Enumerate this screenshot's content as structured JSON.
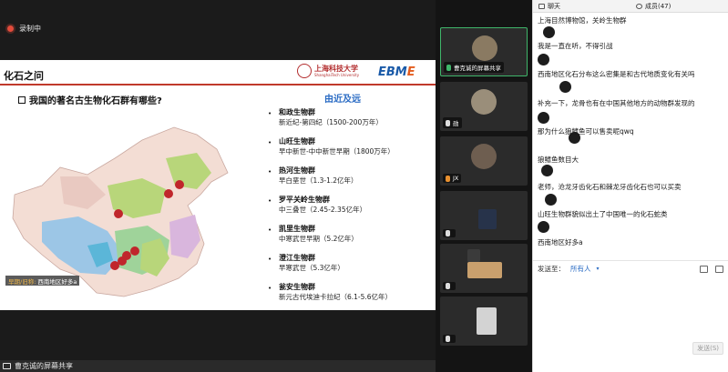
{
  "recording": {
    "label": "录制中"
  },
  "slide": {
    "title": "化石之问",
    "university_name": "上海科技大学",
    "university_sub": "ShanghaiTech University",
    "logo_main": "EBM",
    "logo_accent": "E",
    "question": "我国的著名古生物化石群有哪些?",
    "order": "由近及远",
    "biotas": [
      {
        "name": "和政生物群",
        "age": "新近纪-第四纪（1500-200万年）"
      },
      {
        "name": "山旺生物群",
        "age": "早中新世-中中新世早期（1800万年）"
      },
      {
        "name": "热河生物群",
        "age": "早白垩世（1.3-1.2亿年）"
      },
      {
        "name": "罗平关岭生物群",
        "age": "中三叠世（2.45-2.35亿年）"
      },
      {
        "name": "凯里生物群",
        "age": "中寒武世早期（5.2亿年）"
      },
      {
        "name": "澄江生物群",
        "age": "早寒武世（5.3亿年）"
      },
      {
        "name": "瓮安生物群",
        "age": "新元古代埃迪卡拉纪（6.1-5.6亿年）"
      }
    ],
    "caption_tag": "早期/旧称:",
    "caption_text": "西南地区好多a"
  },
  "share_footer": {
    "label": "曹克诚的屏幕共享"
  },
  "participants": [
    {
      "label": "曹克诚的屏幕共享",
      "active": true
    },
    {
      "label": "勋"
    },
    {
      "label": "JX"
    },
    {
      "label": ""
    },
    {
      "label": ""
    },
    {
      "label": ""
    }
  ],
  "chat": {
    "tab_chat": "聊天",
    "tab_members": "成员(47)",
    "messages": [
      "上海目然博物馆，关岭生物群",
      "我是一直在听，不得引战",
      "西南地区化石分布这么密集是和古代地质变化有关吗",
      "补充一下，龙骨也有在中国其他地方的动物群发现的",
      "那为什么狼鳍鱼可以售卖呢qwq",
      "狼鳍鱼数目大",
      "老师，沧龙牙齿化石和棘龙牙齿化石也可以买卖",
      "山旺生物群貌似出土了中国唯一的化石蛇类",
      "西南地区好多a"
    ],
    "send_to_label": "发送至：",
    "send_to_target": "所有人",
    "send_button": "发送(S)"
  }
}
